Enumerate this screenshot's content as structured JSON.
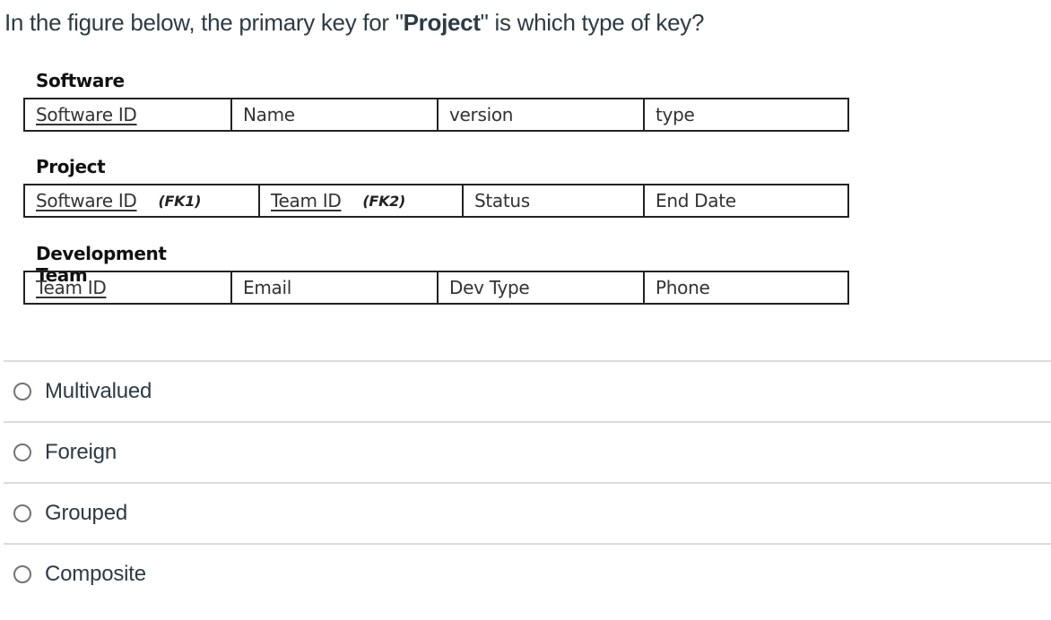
{
  "question": {
    "prefix": "In the figure below, the primary key for \"",
    "emphasis": "Project",
    "suffix": "\" is which type of key?"
  },
  "figure": {
    "entities": [
      {
        "name": "Software",
        "columns": [
          {
            "label": "Software ID",
            "primary_key": true,
            "fk": ""
          },
          {
            "label": "Name",
            "primary_key": false,
            "fk": ""
          },
          {
            "label": "version",
            "primary_key": false,
            "fk": ""
          },
          {
            "label": "type",
            "primary_key": false,
            "fk": ""
          }
        ]
      },
      {
        "name": "Project",
        "columns": [
          {
            "label": "Software ID",
            "primary_key": true,
            "fk": "(FK1)"
          },
          {
            "label": "Team ID",
            "primary_key": true,
            "fk": "(FK2)"
          },
          {
            "label": "Status",
            "primary_key": false,
            "fk": ""
          },
          {
            "label": "End Date",
            "primary_key": false,
            "fk": ""
          }
        ]
      },
      {
        "name": "Development Team",
        "columns": [
          {
            "label": "Team ID",
            "primary_key": true,
            "fk": ""
          },
          {
            "label": "Email",
            "primary_key": false,
            "fk": ""
          },
          {
            "label": "Dev Type",
            "primary_key": false,
            "fk": ""
          },
          {
            "label": "Phone",
            "primary_key": false,
            "fk": ""
          }
        ]
      }
    ]
  },
  "answers": [
    {
      "label": "Multivalued",
      "selected": false
    },
    {
      "label": "Foreign",
      "selected": false
    },
    {
      "label": "Grouped",
      "selected": false
    },
    {
      "label": "Composite",
      "selected": false
    }
  ]
}
